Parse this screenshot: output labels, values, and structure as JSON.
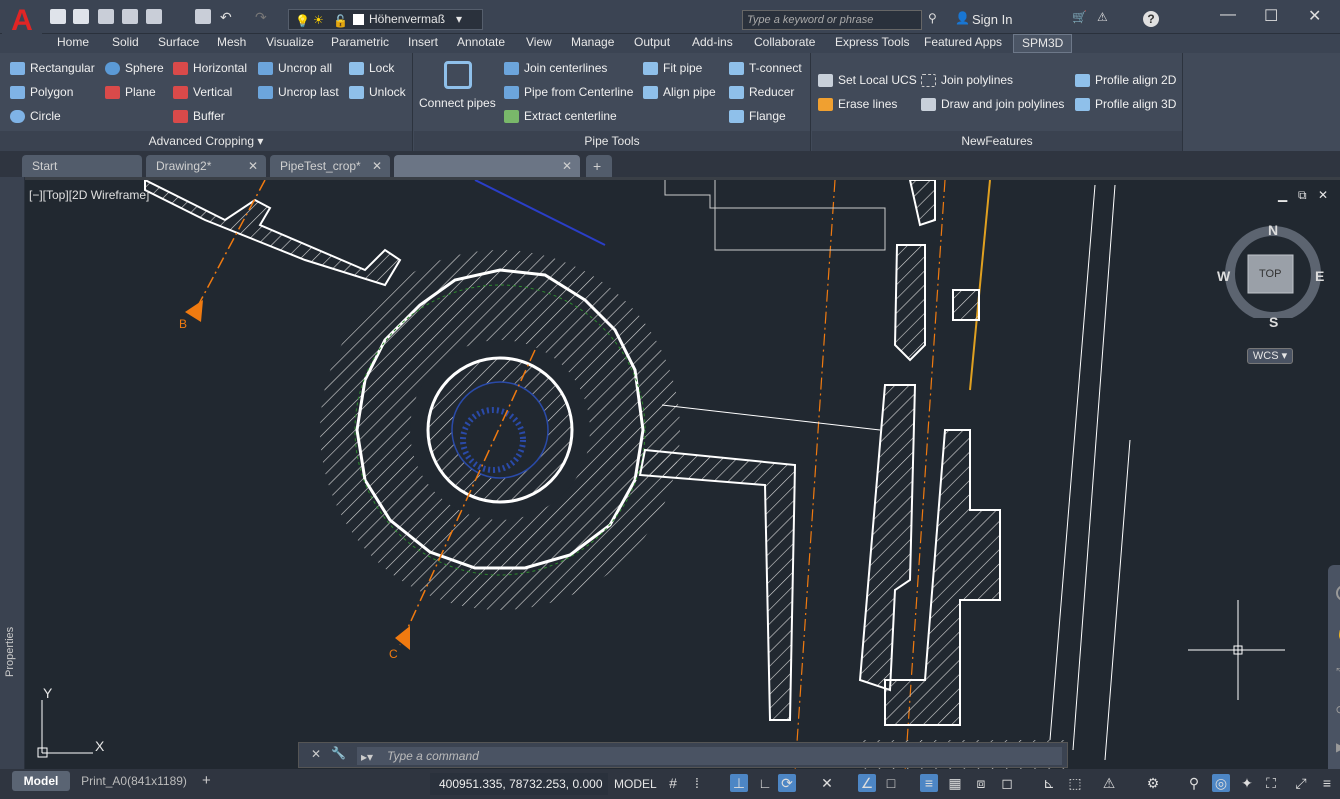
{
  "app": {
    "logo": "A",
    "layer_name": "Höhenvermaß",
    "search_placeholder": "Type a keyword or phrase",
    "signin": "Sign In"
  },
  "menu": [
    "Home",
    "Solid",
    "Surface",
    "Mesh",
    "Visualize",
    "Parametric",
    "Insert",
    "Annotate",
    "View",
    "Manage",
    "Output",
    "Add-ins",
    "Collaborate",
    "Express Tools",
    "Featured Apps",
    "SPM3D"
  ],
  "ribbon": {
    "panel1": {
      "title": "Advanced Cropping",
      "buttons": [
        "Rectangular",
        "Sphere",
        "Horizontal",
        "Uncrop all",
        "Lock",
        "Polygon",
        "Plane",
        "Vertical",
        "Uncrop last",
        "Unlock",
        "Circle",
        "Buffer"
      ]
    },
    "panel2": {
      "title": "Pipe Tools",
      "buttons": [
        "Connect pipes",
        "Join centerlines",
        "Pipe from Centerline",
        "Extract centerline",
        "Fit pipe",
        "Align pipe",
        "T-connect",
        "Reducer",
        "Flange"
      ]
    },
    "panel3": {
      "title": "NewFeatures",
      "buttons": [
        "Set Local UCS",
        "Erase lines",
        "Join polylines",
        "Draw and join polylines",
        "Profile align 2D",
        "Profile align 3D"
      ]
    }
  },
  "file_tabs": [
    "Start",
    "Drawing2*",
    "PipeTest_crop*",
    ""
  ],
  "viewport": {
    "label": "[−][Top][2D Wireframe]",
    "properties": "Properties",
    "navcube": {
      "n": "N",
      "s": "S",
      "e": "E",
      "w": "W",
      "top": "TOP",
      "wcs": "WCS"
    },
    "axis_y": "Y",
    "axis_x": "X",
    "section_b": "B",
    "section_c": "C"
  },
  "command": {
    "placeholder": "Type a command"
  },
  "layout_tabs": [
    "Model",
    "Print_A0(841x1189)"
  ],
  "status": {
    "coords": "400951.335, 78732.253, 0.000",
    "model": "MODEL"
  }
}
